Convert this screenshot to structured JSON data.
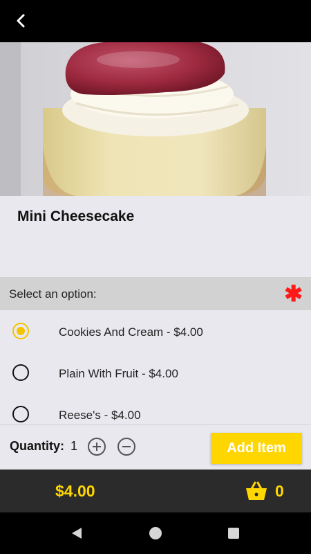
{
  "header": {
    "back_icon": "chevron-left-icon"
  },
  "item": {
    "name": "Mini Cheesecake",
    "image": "cheesecake-photo"
  },
  "options": {
    "header_label": "Select an option:",
    "required_marker": "✱",
    "items": [
      {
        "label": "Cookies And Cream - $4.00",
        "selected": true
      },
      {
        "label": "Plain With Fruit - $4.00",
        "selected": false
      },
      {
        "label": "Reese's - $4.00",
        "selected": false
      }
    ]
  },
  "quantity": {
    "label": "Quantity:",
    "value": "1",
    "increment_icon": "plus-circle-icon",
    "decrement_icon": "minus-circle-icon"
  },
  "add_button_label": "Add Item",
  "footer": {
    "total": "$4.00",
    "cart_icon": "basket-icon",
    "cart_count": "0"
  },
  "colors": {
    "accent": "#ffd600",
    "required": "#ff1a1a",
    "footer_bg": "#2b2b2b"
  }
}
